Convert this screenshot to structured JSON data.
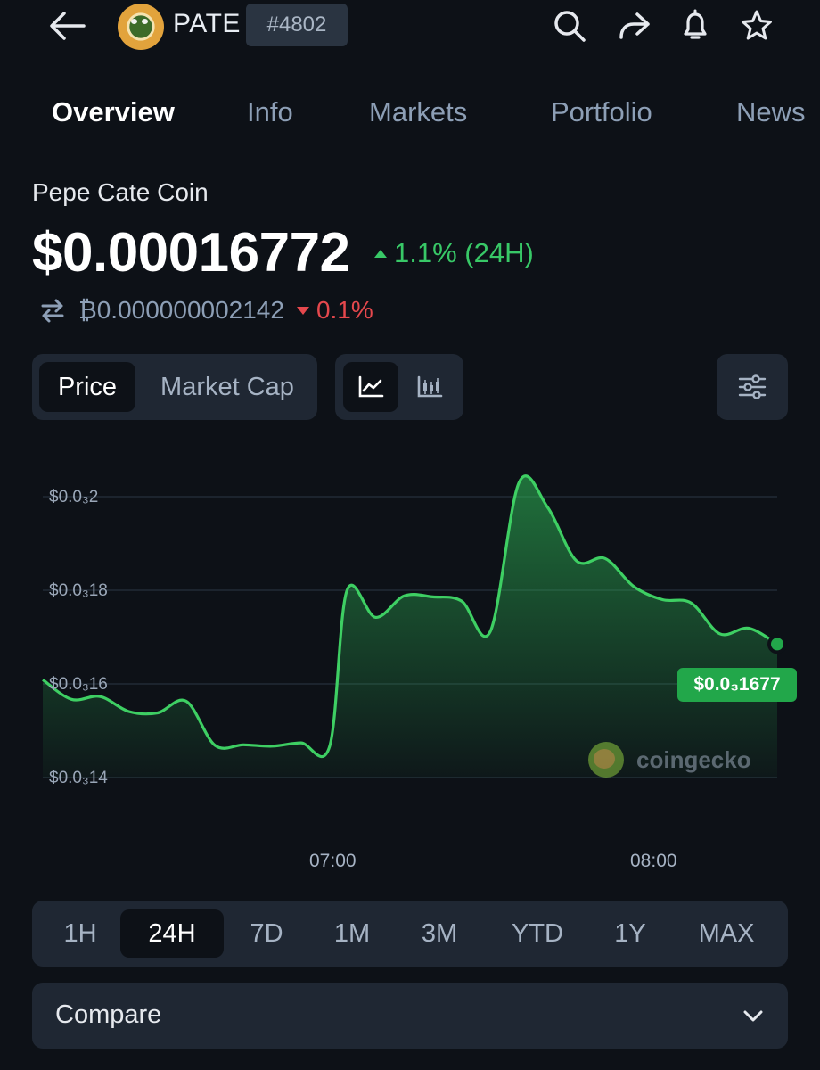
{
  "header": {
    "back_icon": "arrow-left-icon",
    "ticker": "PATE",
    "rank": "#4802",
    "icons": [
      "search-icon",
      "share-icon",
      "bell-icon",
      "star-icon"
    ]
  },
  "tabs": [
    {
      "label": "Overview",
      "active": true
    },
    {
      "label": "Info",
      "active": false
    },
    {
      "label": "Markets",
      "active": false
    },
    {
      "label": "Portfolio",
      "active": false
    },
    {
      "label": "News",
      "active": false
    }
  ],
  "coin": {
    "name": "Pepe Cate Coin",
    "price": "$0.00016772",
    "change_24h": "1.1% (24H)",
    "btc_price": "₿0.000000002142",
    "btc_change": "0.1%"
  },
  "controls": {
    "metric_options": [
      "Price",
      "Market Cap"
    ],
    "selected_metric": "Price",
    "chart_type_icons": [
      "line-chart-icon",
      "candlestick-chart-icon"
    ],
    "settings_icon": "sliders-icon"
  },
  "chart_data": {
    "type": "area",
    "y_ticks": [
      "$0.0₃2",
      "$0.0₃18",
      "$0.0₃16",
      "$0.0₃14"
    ],
    "x_ticks": [
      "07:00",
      "08:00"
    ],
    "ylim": [
      0.000139,
      0.0002
    ],
    "series": [
      {
        "color": "#3ecf63",
        "points": [
          [
            "06:07",
            0.0001609
          ],
          [
            "06:12",
            0.0001567
          ],
          [
            "06:17",
            0.0001573
          ],
          [
            "06:22",
            0.0001541
          ],
          [
            "06:27",
            0.0001538
          ],
          [
            "06:32",
            0.0001563
          ],
          [
            "06:37",
            0.0001469
          ],
          [
            "06:42",
            0.000147
          ],
          [
            "06:47",
            0.0001467
          ],
          [
            "06:52",
            0.0001474
          ],
          [
            "06:57",
            0.0001467
          ],
          [
            "07:00",
            0.0001799
          ],
          [
            "07:05",
            0.0001742
          ],
          [
            "07:10",
            0.0001788
          ],
          [
            "07:15",
            0.0001786
          ],
          [
            "07:20",
            0.0001777
          ],
          [
            "07:25",
            0.0001712
          ],
          [
            "07:30",
            0.000203
          ],
          [
            "07:35",
            0.0001977
          ],
          [
            "07:40",
            0.0001863
          ],
          [
            "07:45",
            0.0001868
          ],
          [
            "07:50",
            0.0001808
          ],
          [
            "07:55",
            0.000178
          ],
          [
            "08:00",
            0.0001773
          ],
          [
            "08:05",
            0.0001707
          ],
          [
            "08:10",
            0.0001719
          ],
          [
            "08:15",
            0.0001685
          ]
        ]
      }
    ],
    "last_price_label": "$0.0₃1677",
    "grid": true
  },
  "watermark": {
    "text": "coingecko"
  },
  "ranges": [
    {
      "label": "1H",
      "active": false
    },
    {
      "label": "24H",
      "active": true
    },
    {
      "label": "7D",
      "active": false
    },
    {
      "label": "1M",
      "active": false
    },
    {
      "label": "3M",
      "active": false
    },
    {
      "label": "YTD",
      "active": false
    },
    {
      "label": "1Y",
      "active": false
    },
    {
      "label": "MAX",
      "active": false
    }
  ],
  "compare": {
    "label": "Compare",
    "icon": "chevron-down-icon"
  },
  "colors": {
    "background": "#0d1117",
    "panel": "#1f2733",
    "up": "#38c867",
    "down": "#e5484d",
    "line": "#3ecf63"
  }
}
